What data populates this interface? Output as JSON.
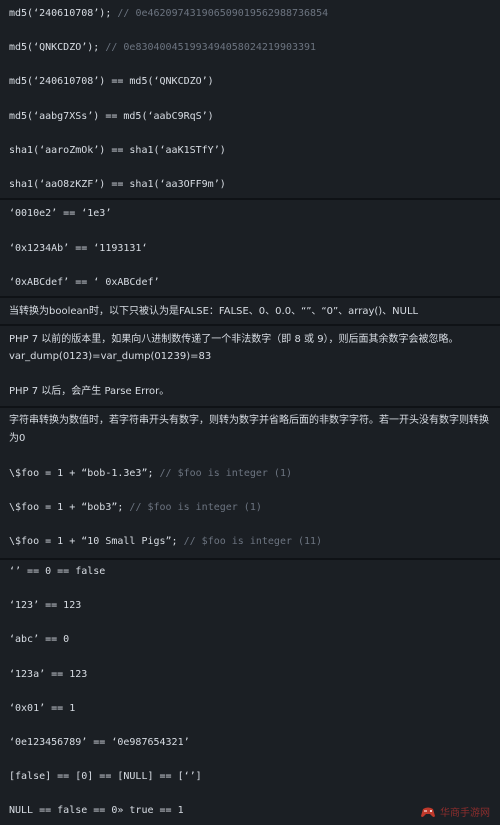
{
  "block1": [
    {
      "code": "md5(‘240610708’);",
      "comment": "// 0e462097431906509019562988736854"
    },
    {
      "code": "md5(‘QNKCDZO’);",
      "comment": "// 0e830400451993494058024219903391"
    },
    {
      "code": "md5(‘240610708’) == md5(‘QNKCDZO’)",
      "comment": ""
    },
    {
      "code": "md5(‘aabg7XSs’) == md5(‘aabC9RqS’)",
      "comment": ""
    },
    {
      "code": "sha1(‘aaroZmOk’) == sha1(‘aaK1STfY’)",
      "comment": ""
    },
    {
      "code": "sha1(‘aaO8zKZF’) == sha1(‘aa3OFF9m’)",
      "comment": ""
    }
  ],
  "block2": [
    {
      "code": "‘0010e2’ == ‘1e3’"
    },
    {
      "code": "‘0x1234Ab’ == ‘1193131‘"
    },
    {
      "code": "‘0xABCdef’ == ‘ 0xABCdef’"
    }
  ],
  "block3": {
    "text": "当转换为boolean时，以下只被认为是FALSE：FALSE、0、0.0、“”、“0”、array()、NULL"
  },
  "block4": {
    "para1": "PHP 7 以前的版本里，如果向八进制数传递了一个非法数字（即 8 或 9），则后面其余数字会被忽略。",
    "para2": "var_dump(0123)=var_dump(01239)=83",
    "para3": "PHP 7 以后，会产生 Parse Error。"
  },
  "block5": {
    "intro": "字符串转换为数值时，若字符串开头有数字，则转为数字并省略后面的非数字字符。若一开头没有数字则转换为0",
    "lines": [
      {
        "code": "\\$foo = 1 + “bob-1.3e3”;",
        "comment": "// $foo is integer (1)"
      },
      {
        "code": "\\$foo = 1 + “bob3”;",
        "comment": "// $foo is integer (1)"
      },
      {
        "code": "\\$foo = 1 + “10 Small Pigs”;",
        "comment": "// $foo is integer (11)"
      }
    ]
  },
  "block6": [
    {
      "code": "‘’ == 0 == false"
    },
    {
      "code": "‘123’ == 123"
    },
    {
      "code": "‘abc’ == 0"
    },
    {
      "code": "‘123a’ == 123"
    },
    {
      "code": "‘0x01’ == 1"
    },
    {
      "code": "‘0e123456789’ == ‘0e987654321’"
    },
    {
      "code": "[false] == [0] == [NULL] == [‘’]"
    },
    {
      "code": "NULL == false == 0» true == 1"
    }
  ],
  "watermark": {
    "text": "华商手游网",
    "icon": "controller-logo-icon"
  }
}
